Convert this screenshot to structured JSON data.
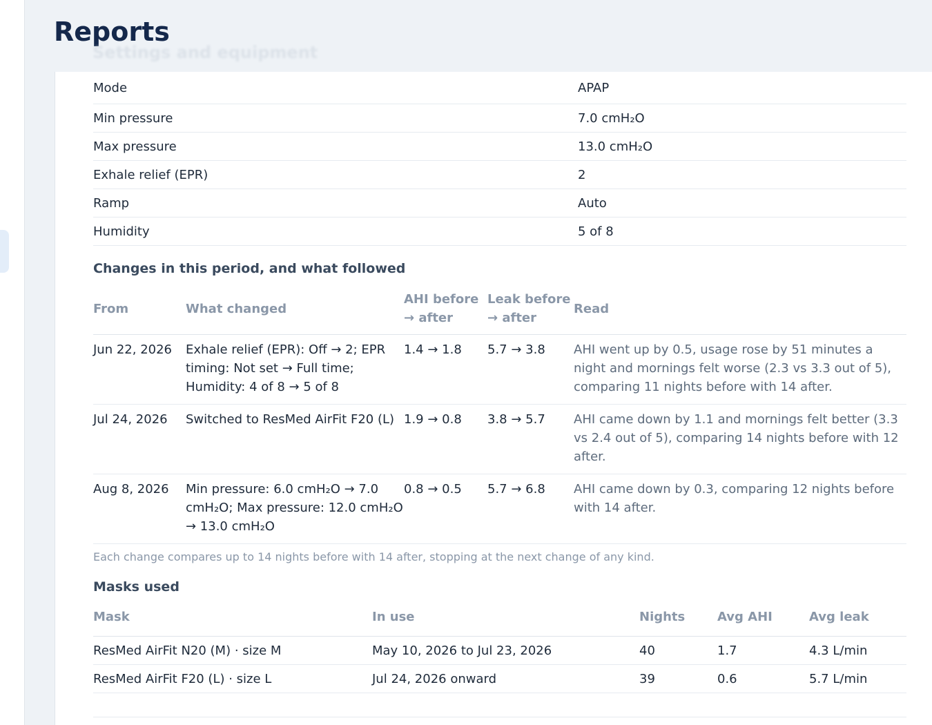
{
  "page": {
    "title": "Reports",
    "ghost_heading": "Settings and equipment"
  },
  "settings": [
    {
      "label": "Mode",
      "value": "APAP"
    },
    {
      "label": "Min pressure",
      "value": "7.0 cmH₂O"
    },
    {
      "label": "Max pressure",
      "value": "13.0 cmH₂O"
    },
    {
      "label": "Exhale relief (EPR)",
      "value": "2"
    },
    {
      "label": "Ramp",
      "value": "Auto"
    },
    {
      "label": "Humidity",
      "value": "5 of 8"
    }
  ],
  "changes": {
    "title": "Changes in this period, and what followed",
    "headers": {
      "from": "From",
      "what": "What changed",
      "ahi": "AHI before → after",
      "leak": "Leak before → after",
      "read": "Read"
    },
    "rows": [
      {
        "from": "Jun 22, 2026",
        "what": "Exhale relief (EPR): Off → 2; EPR timing: Not set → Full time; Humidity: 4 of 8 → 5 of 8",
        "ahi": "1.4 → 1.8",
        "leak": "5.7 → 3.8",
        "read": "AHI went up by 0.5, usage rose by 51 minutes a night and mornings felt worse (2.3 vs 3.3 out of 5), comparing 11 nights before with 14 after."
      },
      {
        "from": "Jul 24, 2026",
        "what": "Switched to ResMed AirFit F20 (L)",
        "ahi": "1.9 → 0.8",
        "leak": "3.8 → 5.7",
        "read": "AHI came down by 1.1 and mornings felt better (3.3 vs 2.4 out of 5), comparing 14 nights before with 12 after."
      },
      {
        "from": "Aug 8, 2026",
        "what": "Min pressure: 6.0 cmH₂O → 7.0 cmH₂O; Max pressure: 12.0 cmH₂O → 13.0 cmH₂O",
        "ahi": "0.8 → 0.5",
        "leak": "5.7 → 6.8",
        "read": "AHI came down by 0.3, comparing 12 nights before with 14 after."
      }
    ],
    "footnote": "Each change compares up to 14 nights before with 14 after, stopping at the next change of any kind."
  },
  "masks": {
    "title": "Masks used",
    "headers": {
      "mask": "Mask",
      "in_use": "In use",
      "nights": "Nights",
      "avg_ahi": "Avg AHI",
      "avg_leak": "Avg leak"
    },
    "rows": [
      {
        "mask": "ResMed AirFit N20 (M) · size M",
        "in_use": "May 10, 2026 to Jul 23, 2026",
        "nights": "40",
        "avg_ahi": "1.7",
        "avg_leak": "4.3 L/min"
      },
      {
        "mask": "ResMed AirFit F20 (L) · size L",
        "in_use": "Jul 24, 2026 onward",
        "nights": "39",
        "avg_ahi": "0.6",
        "avg_leak": "5.7 L/min"
      }
    ]
  }
}
